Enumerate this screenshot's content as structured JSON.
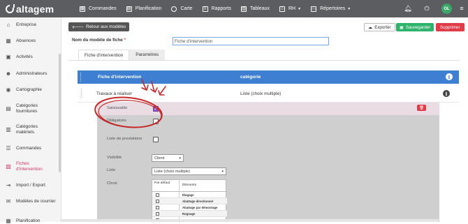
{
  "app": {
    "brand": "altagem"
  },
  "topnav": [
    {
      "label": "Commandes",
      "icon": "grid-icon",
      "caret": false
    },
    {
      "label": "Planification",
      "icon": "calendar-icon",
      "caret": false
    },
    {
      "label": "Carte",
      "icon": "map-pin-icon",
      "caret": false
    },
    {
      "label": "Rapports",
      "icon": "report-icon",
      "caret": false
    },
    {
      "label": "Tableaux",
      "icon": "table-icon",
      "caret": false
    },
    {
      "label": "RH",
      "icon": "people-icon",
      "caret": true
    },
    {
      "label": "Répertoires",
      "icon": "folder-icon",
      "caret": true
    }
  ],
  "topright": {
    "bell": "bell-icon",
    "power": "power-icon",
    "avatar": "OL"
  },
  "sidebar": {
    "items": [
      {
        "label": "Entreprise",
        "icon": "home-icon",
        "active": false
      },
      {
        "label": "Absences",
        "icon": "calendar-icon",
        "active": false
      },
      {
        "label": "Activités",
        "icon": "activity-icon",
        "active": false
      },
      {
        "label": "Administrateurs",
        "icon": "users-icon",
        "active": false
      },
      {
        "label": "Cartographie",
        "icon": "map-marker-icon",
        "active": false
      },
      {
        "label": "Catégories fournitures",
        "icon": "supplies-icon",
        "active": false
      },
      {
        "label": "Catégories matériels",
        "icon": "equipment-icon",
        "active": false
      },
      {
        "label": "Commandes",
        "icon": "list-icon",
        "active": false
      },
      {
        "label": "Fiches d'intervention",
        "icon": "clipboard-icon",
        "active": true
      },
      {
        "label": "Import / Export",
        "icon": "import-export-icon",
        "active": false
      },
      {
        "label": "Modèles de courrier",
        "icon": "mail-template-icon",
        "active": false
      },
      {
        "label": "Planification",
        "icon": "planning-icon",
        "active": false
      }
    ]
  },
  "toolbar": {
    "back_label": "Retour aux modèles",
    "export_label": "Exporter",
    "save_label": "Sauvegarder",
    "delete_label": "Supprimer"
  },
  "form": {
    "name_label": "Nom du modèle de fiche",
    "required_mark": "*",
    "name_value": "Fiche d'intervention"
  },
  "tabs": [
    {
      "label": "Fiche d'intervention",
      "active": true
    },
    {
      "label": "Paramètres",
      "active": false
    }
  ],
  "table": {
    "col1": "Fiche d'intervention",
    "col2": "catégorie",
    "row": {
      "name": "Travaux à réaliser",
      "category": "Liste (choix multiple)"
    }
  },
  "details": {
    "saisissable_label": "Saisissable",
    "saisissable_checked": true,
    "obligatoire_label": "Obligatoire",
    "obligatoire_checked": false,
    "prestations_label": "Liste de prestations",
    "prestations_checked": false,
    "visibilite_label": "Visibilité",
    "visibilite_value": "Client",
    "liste_label": "Liste",
    "liste_value": "Liste (choix multiple)",
    "choix_label": "Choix",
    "choix_header_default": "Par défaut",
    "choix_header_elements": "Éléments",
    "choix_rows": [
      "Élagage",
      "Abattage directionnel",
      "Abattage par démontage",
      "Rognage",
      ""
    ]
  },
  "colors": {
    "topbar": "#5b5d60",
    "accent": "#3f7fd1",
    "active_sidebar": "#d6336c",
    "save": "#2fb36b",
    "delete": "#e13b48",
    "annotation": "#c42828"
  }
}
